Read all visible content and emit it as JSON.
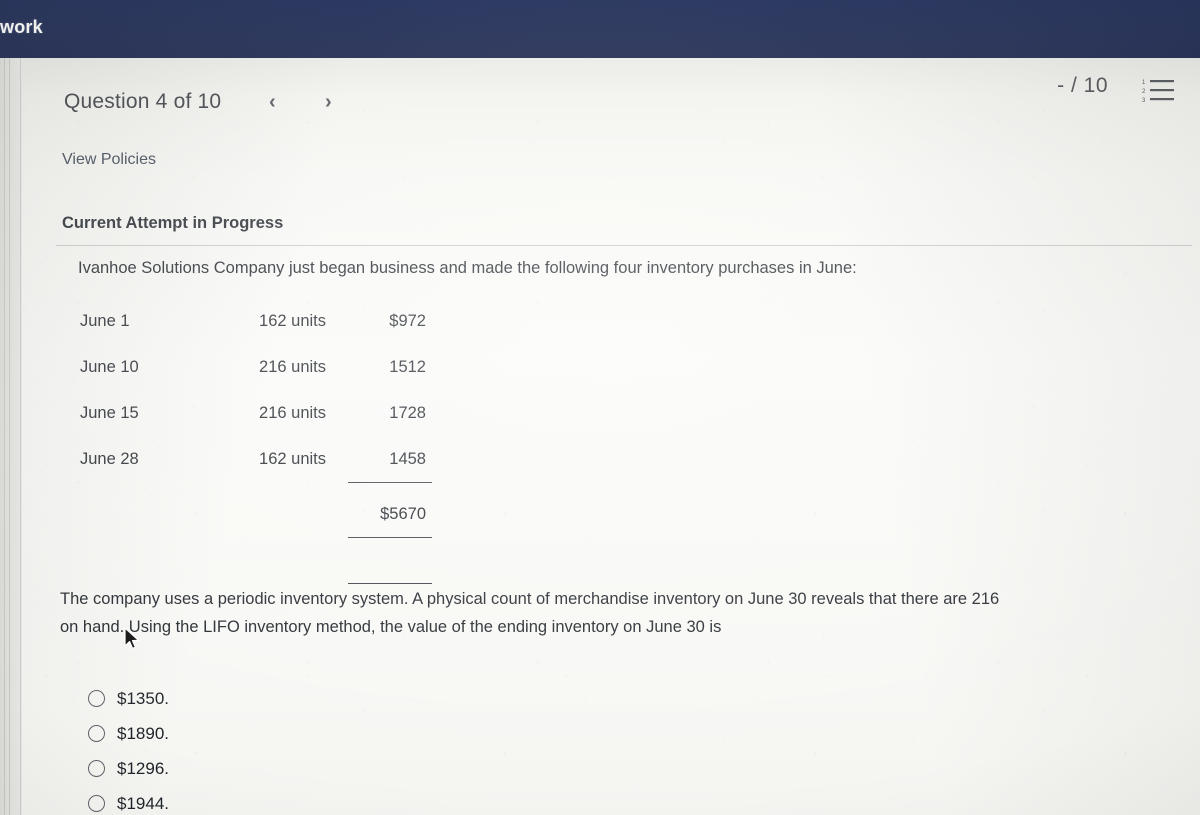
{
  "banner": {
    "title": "work"
  },
  "header": {
    "question_title": "Question 4 of 10",
    "prev_icon": "‹",
    "next_icon": "›",
    "score": "- / 10",
    "list_icon_name": "numbered-list-icon"
  },
  "links": {
    "view_policies": "View Policies"
  },
  "section": {
    "attempt_status": "Current Attempt in Progress"
  },
  "question": {
    "intro": "Ivanhoe Solutions Company just began business and made the following four inventory purchases in June:",
    "prompt_line_1": "The company uses a periodic inventory system. A physical count of merchandise inventory on June 30 reveals that there are 216",
    "prompt_line_2": "on hand. Using the LIFO inventory method, the value of the ending inventory on June 30 is"
  },
  "purchases": {
    "rows": [
      {
        "date": "June  1",
        "units": "162 units",
        "amount": "$972"
      },
      {
        "date": "June  10",
        "units": "216 units",
        "amount": "1512"
      },
      {
        "date": "June  15",
        "units": "216 units",
        "amount": "1728"
      },
      {
        "date": "June  28",
        "units": "162 units",
        "amount": "1458"
      }
    ],
    "total": "$5670"
  },
  "options": [
    {
      "label": "$1350.",
      "selected": false
    },
    {
      "label": "$1890.",
      "selected": false
    },
    {
      "label": "$1296.",
      "selected": false
    },
    {
      "label": "$1944.",
      "selected": false
    }
  ],
  "colors": {
    "banner_navy": "#1a2650",
    "page_background": "#f7f7f4",
    "text_primary": "#20252b",
    "text_muted": "#45494f",
    "rule": "#3a3f44"
  }
}
